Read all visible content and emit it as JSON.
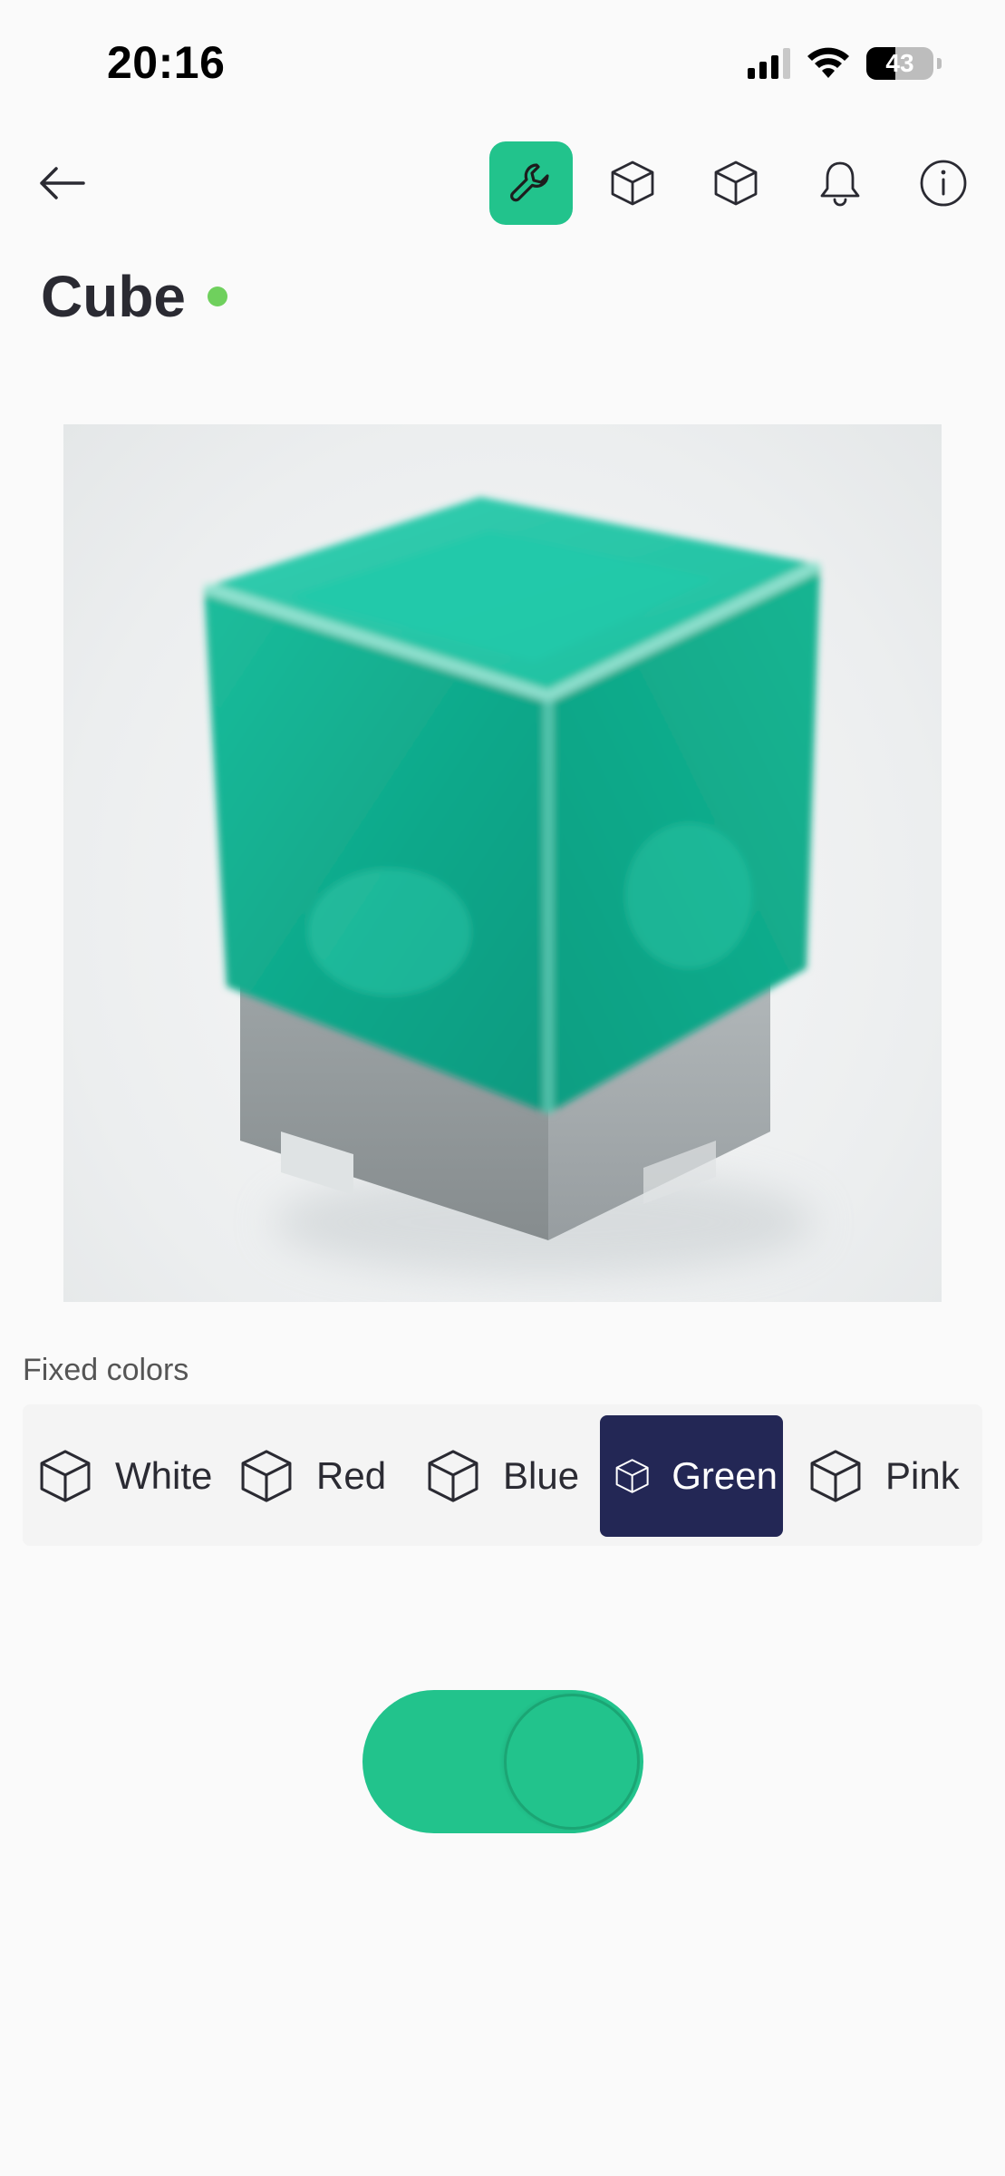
{
  "status_bar": {
    "time": "20:16",
    "battery_percent": "43",
    "battery_level": 0.43
  },
  "nav": {
    "back_icon": "arrow-left-icon",
    "icons": [
      "wrench-icon",
      "cube-icon",
      "cube-icon",
      "bell-icon",
      "info-icon"
    ],
    "active_index": 0
  },
  "device": {
    "title": "Cube",
    "online_status_color": "#6fd05d"
  },
  "fixed_colors": {
    "label": "Fixed colors",
    "options": [
      {
        "label": "White",
        "icon": "cube-icon"
      },
      {
        "label": "Red",
        "icon": "cube-icon"
      },
      {
        "label": "Blue",
        "icon": "cube-icon"
      },
      {
        "label": "Green",
        "icon": "cube-icon"
      },
      {
        "label": "Pink",
        "icon": "cube-icon"
      }
    ],
    "selected_index": 3
  },
  "power": {
    "on": true
  },
  "colors": {
    "accent": "#22c38c",
    "selected_chip": "#232755",
    "online_dot": "#6fd05d"
  }
}
